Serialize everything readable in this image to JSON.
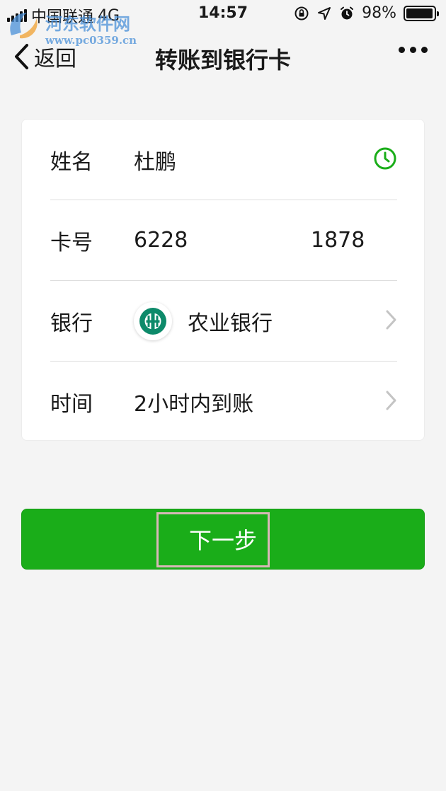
{
  "status_bar": {
    "carrier": "中国联通",
    "network": "4G",
    "time": "14:57",
    "battery": "98%",
    "battery_level": 0.98
  },
  "watermark": {
    "title": "河东软件网",
    "url": "www.pc0359.cn"
  },
  "nav": {
    "back_label": "返回",
    "title": "转账到银行卡"
  },
  "form": {
    "name_label": "姓名",
    "name_value": "杜鹏",
    "card_label": "卡号",
    "card_prefix": "6228",
    "card_suffix": "1878",
    "bank_label": "银行",
    "bank_value": "农业银行",
    "time_label": "时间",
    "time_value": "2小时内到账"
  },
  "actions": {
    "next_label": "下一步"
  },
  "colors": {
    "accent_green": "#1aad19",
    "bank_logo_green": "#0d8a6a"
  }
}
